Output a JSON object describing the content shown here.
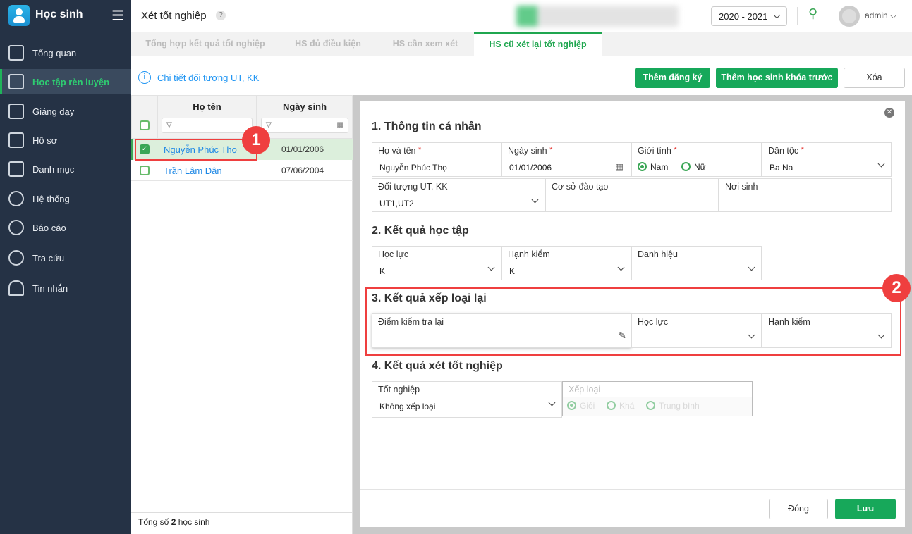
{
  "app": {
    "title": "Học sinh"
  },
  "sidebar": {
    "items": [
      {
        "label": "Tổng quan"
      },
      {
        "label": "Học tập rèn luyện"
      },
      {
        "label": "Giảng dạy"
      },
      {
        "label": "Hồ sơ"
      },
      {
        "label": "Danh mục"
      },
      {
        "label": "Hệ thống"
      },
      {
        "label": "Báo cáo"
      },
      {
        "label": "Tra cứu"
      },
      {
        "label": "Tin nhắn"
      }
    ]
  },
  "header": {
    "title": "Xét tốt nghiệp",
    "help": "?",
    "year": "2020 - 2021",
    "user": "admin"
  },
  "tabs": [
    {
      "label": "Tổng hợp kết quả tốt nghiệp"
    },
    {
      "label": "HS đủ điều kiện"
    },
    {
      "label": "HS cần xem xét"
    },
    {
      "label": "HS cũ xét lại tốt nghiệp"
    }
  ],
  "toolbar": {
    "info_link": "Chi tiết đối tượng UT, KK",
    "add_register": "Thêm đăng ký",
    "add_prev": "Thêm học sinh khóa trước",
    "delete": "Xóa"
  },
  "list": {
    "col_name": "Họ tên",
    "col_dob": "Ngày sinh",
    "rows": [
      {
        "name": "Nguyễn Phúc Thọ",
        "dob": "01/01/2006",
        "checked": true
      },
      {
        "name": "Trần Lâm Dân",
        "dob": "07/06/2004",
        "checked": false
      }
    ],
    "footer_prefix": "Tổng số ",
    "footer_count": "2",
    "footer_suffix": " học sinh"
  },
  "modal": {
    "s1": {
      "title": "1. Thông tin cá nhân",
      "name_label": "Họ và tên",
      "name": "Nguyễn Phúc Thọ",
      "dob_label": "Ngày sinh",
      "dob": "01/01/2006",
      "gender_label": "Giới tính",
      "male": "Nam",
      "female": "Nữ",
      "ethnic_label": "Dân tộc",
      "ethnic": "Ba Na",
      "priority_label": "Đối tượng UT, KK",
      "priority": "UT1,UT2",
      "school_label": "Cơ sở đào tạo",
      "birthplace_label": "Nơi sinh",
      "req": "*"
    },
    "s2": {
      "title": "2. Kết quả học tập",
      "academic_label": "Học lực",
      "academic": "K",
      "conduct_label": "Hạnh kiểm",
      "conduct": "K",
      "title_label": "Danh hiệu"
    },
    "s3": {
      "title": "3. Kết quả xếp loại lại",
      "score_label": "Điểm kiểm tra lại",
      "academic_label": "Học lực",
      "conduct_label": "Hạnh kiểm"
    },
    "s4": {
      "title": "4. Kết quả xét tốt nghiệp",
      "grad_label": "Tốt nghiệp",
      "grad": "Không xếp loại",
      "rank_label": "Xếp loại",
      "ranks": [
        "Giỏi",
        "Khá",
        "Trung bình"
      ]
    },
    "close": "Đóng",
    "save": "Lưu"
  },
  "annotations": [
    "1",
    "2"
  ],
  "colors": {
    "sidebar": "#253245",
    "accent": "#17a85a",
    "marker": "#ef3f3f"
  }
}
